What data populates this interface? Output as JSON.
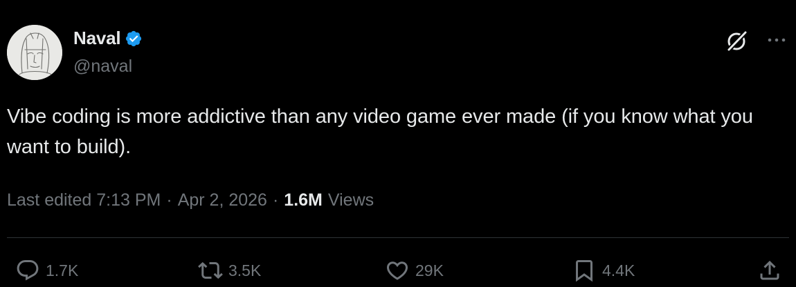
{
  "author": {
    "display_name": "Naval",
    "handle": "@naval",
    "verified": true,
    "avatar_icon": "sketch-portrait-avatar",
    "verified_color": "#1d9bf0"
  },
  "header_actions": {
    "grok_icon": "grok-icon",
    "more_icon": "more-dots-icon"
  },
  "tweet": {
    "text": "Vibe coding is more addictive than any video game ever made (if you know what you want to build)."
  },
  "meta": {
    "edited_label": "Last edited 7:13 PM",
    "separator": "·",
    "date": "Apr 2, 2026",
    "views_count": "1.6M",
    "views_label": "Views"
  },
  "actions": {
    "replies": "1.7K",
    "reposts": "3.5K",
    "likes": "29K",
    "bookmarks": "4.4K"
  },
  "colors": {
    "background": "#000000",
    "primary_text": "#e7e9ea",
    "secondary_text": "#71767b",
    "divider": "#2f3336"
  }
}
